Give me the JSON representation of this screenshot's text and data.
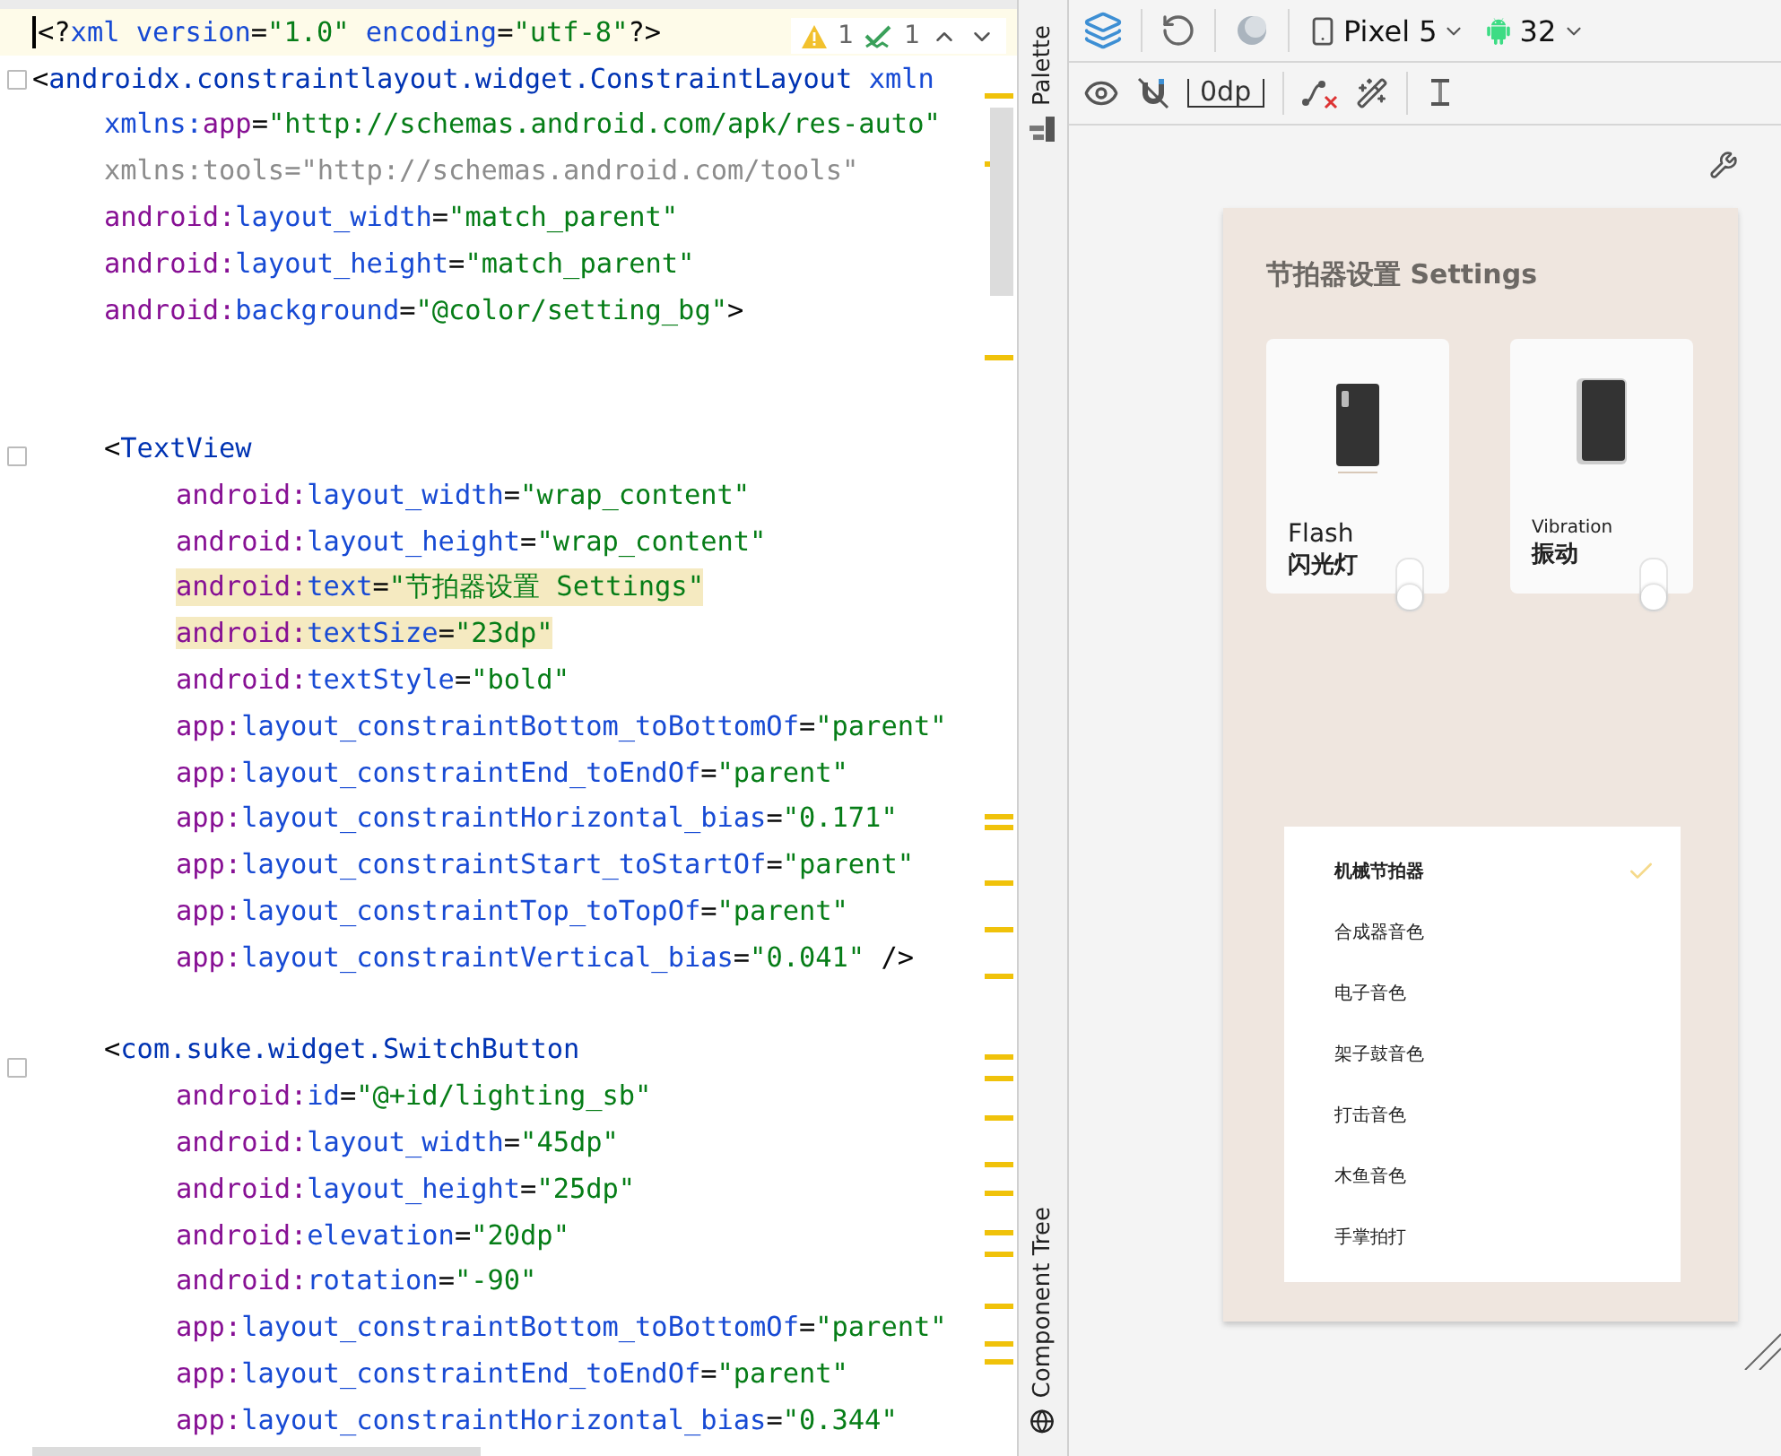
{
  "editor": {
    "inspections": {
      "warnings": "1",
      "weak_warnings": "1"
    },
    "lines": [
      {
        "kind": "root",
        "current": true,
        "highlighted": false,
        "tokens": [
          {
            "kind": "punct",
            "text": "<?"
          },
          {
            "kind": "attr",
            "text": "xml version"
          },
          {
            "kind": "punct",
            "text": "="
          },
          {
            "kind": "value",
            "text": "\"1.0\""
          },
          {
            "kind": "attr",
            "text": " encoding"
          },
          {
            "kind": "punct",
            "text": "="
          },
          {
            "kind": "value",
            "text": "\"utf-8\""
          },
          {
            "kind": "punct",
            "text": "?>"
          }
        ]
      },
      {
        "kind": "root",
        "current": false,
        "highlighted": false,
        "tokens": [
          {
            "kind": "punct",
            "text": "<"
          },
          {
            "kind": "tag",
            "text": "androidx.constraintlayout.widget.ConstraintLayout"
          },
          {
            "kind": "attr",
            "text": " xmln"
          }
        ]
      },
      {
        "kind": "root-attr",
        "current": false,
        "highlighted": false,
        "tokens": [
          {
            "kind": "attr",
            "text": "xmlns:"
          },
          {
            "kind": "ns",
            "text": "app"
          },
          {
            "kind": "punct",
            "text": "="
          },
          {
            "kind": "value",
            "text": "\"http://schemas.android.com/apk/res-auto\""
          }
        ]
      },
      {
        "kind": "root-attr",
        "current": false,
        "highlighted": false,
        "tokens": [
          {
            "kind": "muted",
            "text": "xmlns:tools=\"http://schemas.android.com/tools\""
          }
        ]
      },
      {
        "kind": "root-attr",
        "current": false,
        "highlighted": false,
        "tokens": [
          {
            "kind": "ns",
            "text": "android:"
          },
          {
            "kind": "attr",
            "text": "layout_width"
          },
          {
            "kind": "punct",
            "text": "="
          },
          {
            "kind": "value",
            "text": "\"match_parent\""
          }
        ]
      },
      {
        "kind": "root-attr",
        "current": false,
        "highlighted": false,
        "tokens": [
          {
            "kind": "ns",
            "text": "android:"
          },
          {
            "kind": "attr",
            "text": "layout_height"
          },
          {
            "kind": "punct",
            "text": "="
          },
          {
            "kind": "value",
            "text": "\"match_parent\""
          }
        ]
      },
      {
        "kind": "root-attr",
        "current": false,
        "highlighted": false,
        "tokens": [
          {
            "kind": "ns",
            "text": "android:"
          },
          {
            "kind": "attr",
            "text": "background"
          },
          {
            "kind": "punct",
            "text": "="
          },
          {
            "kind": "value",
            "text": "\"@color/setting_bg\""
          },
          {
            "kind": "punct",
            "text": ">"
          }
        ]
      },
      {
        "kind": "blank"
      },
      {
        "kind": "blank"
      },
      {
        "kind": "tag",
        "current": false,
        "highlighted": false,
        "tokens": [
          {
            "kind": "punct",
            "text": "<"
          },
          {
            "kind": "tag",
            "text": "TextView"
          }
        ]
      },
      {
        "kind": "attr",
        "current": false,
        "highlighted": false,
        "tokens": [
          {
            "kind": "ns",
            "text": "android:"
          },
          {
            "kind": "attr",
            "text": "layout_width"
          },
          {
            "kind": "punct",
            "text": "="
          },
          {
            "kind": "value",
            "text": "\"wrap_content\""
          }
        ]
      },
      {
        "kind": "attr",
        "current": false,
        "highlighted": false,
        "tokens": [
          {
            "kind": "ns",
            "text": "android:"
          },
          {
            "kind": "attr",
            "text": "layout_height"
          },
          {
            "kind": "punct",
            "text": "="
          },
          {
            "kind": "value",
            "text": "\"wrap_content\""
          }
        ]
      },
      {
        "kind": "attr",
        "current": false,
        "highlighted": true,
        "tokens": [
          {
            "kind": "ns",
            "text": "android:"
          },
          {
            "kind": "attr",
            "text": "text"
          },
          {
            "kind": "punct",
            "text": "="
          },
          {
            "kind": "value",
            "text": "\"节拍器设置 Settings\""
          }
        ]
      },
      {
        "kind": "attr",
        "current": false,
        "highlighted": true,
        "tokens": [
          {
            "kind": "ns",
            "text": "android:"
          },
          {
            "kind": "attr",
            "text": "textSize"
          },
          {
            "kind": "punct",
            "text": "="
          },
          {
            "kind": "value",
            "text": "\"23dp\""
          }
        ]
      },
      {
        "kind": "attr",
        "current": false,
        "highlighted": false,
        "tokens": [
          {
            "kind": "ns",
            "text": "android:"
          },
          {
            "kind": "attr",
            "text": "textStyle"
          },
          {
            "kind": "punct",
            "text": "="
          },
          {
            "kind": "value",
            "text": "\"bold\""
          }
        ]
      },
      {
        "kind": "attr",
        "current": false,
        "highlighted": false,
        "tokens": [
          {
            "kind": "ns",
            "text": "app:"
          },
          {
            "kind": "attr",
            "text": "layout_constraintBottom_toBottomOf"
          },
          {
            "kind": "punct",
            "text": "="
          },
          {
            "kind": "value",
            "text": "\"parent\""
          }
        ]
      },
      {
        "kind": "attr",
        "current": false,
        "highlighted": false,
        "tokens": [
          {
            "kind": "ns",
            "text": "app:"
          },
          {
            "kind": "attr",
            "text": "layout_constraintEnd_toEndOf"
          },
          {
            "kind": "punct",
            "text": "="
          },
          {
            "kind": "value",
            "text": "\"parent\""
          }
        ]
      },
      {
        "kind": "attr",
        "current": false,
        "highlighted": false,
        "tokens": [
          {
            "kind": "ns",
            "text": "app:"
          },
          {
            "kind": "attr",
            "text": "layout_constraintHorizontal_bias"
          },
          {
            "kind": "punct",
            "text": "="
          },
          {
            "kind": "value",
            "text": "\"0.171\""
          }
        ]
      },
      {
        "kind": "attr",
        "current": false,
        "highlighted": false,
        "tokens": [
          {
            "kind": "ns",
            "text": "app:"
          },
          {
            "kind": "attr",
            "text": "layout_constraintStart_toStartOf"
          },
          {
            "kind": "punct",
            "text": "="
          },
          {
            "kind": "value",
            "text": "\"parent\""
          }
        ]
      },
      {
        "kind": "attr",
        "current": false,
        "highlighted": false,
        "tokens": [
          {
            "kind": "ns",
            "text": "app:"
          },
          {
            "kind": "attr",
            "text": "layout_constraintTop_toTopOf"
          },
          {
            "kind": "punct",
            "text": "="
          },
          {
            "kind": "value",
            "text": "\"parent\""
          }
        ]
      },
      {
        "kind": "attr",
        "current": false,
        "highlighted": false,
        "tokens": [
          {
            "kind": "ns",
            "text": "app:"
          },
          {
            "kind": "attr",
            "text": "layout_constraintVertical_bias"
          },
          {
            "kind": "punct",
            "text": "="
          },
          {
            "kind": "value",
            "text": "\"0.041\""
          },
          {
            "kind": "punct",
            "text": " />"
          }
        ]
      },
      {
        "kind": "blank"
      },
      {
        "kind": "tag",
        "current": false,
        "highlighted": false,
        "tokens": [
          {
            "kind": "punct",
            "text": "<"
          },
          {
            "kind": "tag",
            "text": "com.suke.widget.SwitchButton"
          }
        ]
      },
      {
        "kind": "attr",
        "current": false,
        "highlighted": false,
        "tokens": [
          {
            "kind": "ns",
            "text": "android:"
          },
          {
            "kind": "attr",
            "text": "id"
          },
          {
            "kind": "punct",
            "text": "="
          },
          {
            "kind": "value",
            "text": "\"@+id/lighting_sb\""
          }
        ]
      },
      {
        "kind": "attr",
        "current": false,
        "highlighted": false,
        "tokens": [
          {
            "kind": "ns",
            "text": "android:"
          },
          {
            "kind": "attr",
            "text": "layout_width"
          },
          {
            "kind": "punct",
            "text": "="
          },
          {
            "kind": "value",
            "text": "\"45dp\""
          }
        ]
      },
      {
        "kind": "attr",
        "current": false,
        "highlighted": false,
        "tokens": [
          {
            "kind": "ns",
            "text": "android:"
          },
          {
            "kind": "attr",
            "text": "layout_height"
          },
          {
            "kind": "punct",
            "text": "="
          },
          {
            "kind": "value",
            "text": "\"25dp\""
          }
        ]
      },
      {
        "kind": "attr",
        "current": false,
        "highlighted": false,
        "tokens": [
          {
            "kind": "ns",
            "text": "android:"
          },
          {
            "kind": "attr",
            "text": "elevation"
          },
          {
            "kind": "punct",
            "text": "="
          },
          {
            "kind": "value",
            "text": "\"20dp\""
          }
        ]
      },
      {
        "kind": "attr",
        "current": false,
        "highlighted": false,
        "tokens": [
          {
            "kind": "ns",
            "text": "android:"
          },
          {
            "kind": "attr",
            "text": "rotation"
          },
          {
            "kind": "punct",
            "text": "="
          },
          {
            "kind": "value",
            "text": "\"-90\""
          }
        ]
      },
      {
        "kind": "attr",
        "current": false,
        "highlighted": false,
        "tokens": [
          {
            "kind": "ns",
            "text": "app:"
          },
          {
            "kind": "attr",
            "text": "layout_constraintBottom_toBottomOf"
          },
          {
            "kind": "punct",
            "text": "="
          },
          {
            "kind": "value",
            "text": "\"parent\""
          }
        ]
      },
      {
        "kind": "attr",
        "current": false,
        "highlighted": false,
        "tokens": [
          {
            "kind": "ns",
            "text": "app:"
          },
          {
            "kind": "attr",
            "text": "layout_constraintEnd_toEndOf"
          },
          {
            "kind": "punct",
            "text": "="
          },
          {
            "kind": "value",
            "text": "\"parent\""
          }
        ]
      },
      {
        "kind": "attr",
        "current": false,
        "highlighted": false,
        "tokens": [
          {
            "kind": "ns",
            "text": "app:"
          },
          {
            "kind": "attr",
            "text": "layout_constraintHorizontal_bias"
          },
          {
            "kind": "punct",
            "text": "="
          },
          {
            "kind": "value",
            "text": "\"0.344\""
          }
        ]
      }
    ]
  },
  "side_tabs": [
    "Palette",
    "Component Tree"
  ],
  "toolbar": {
    "device": "Pixel 5",
    "api": "32",
    "margin": "0dp"
  },
  "preview": {
    "title": "节拍器设置 Settings",
    "cards": [
      {
        "kind": "flash",
        "label_en": "Flash",
        "label_zh": "闪光灯",
        "on": false
      },
      {
        "kind": "vibration",
        "label_en": "Vibration",
        "label_zh": "振动",
        "on": false
      }
    ],
    "sounds": [
      {
        "label": "机械节拍器",
        "selected": true
      },
      {
        "label": "合成器音色",
        "selected": false
      },
      {
        "label": "电子音色",
        "selected": false
      },
      {
        "label": "架子鼓音色",
        "selected": false
      },
      {
        "label": "打击音色",
        "selected": false
      },
      {
        "label": "木鱼音色",
        "selected": false
      },
      {
        "label": "手掌拍打",
        "selected": false
      }
    ]
  }
}
